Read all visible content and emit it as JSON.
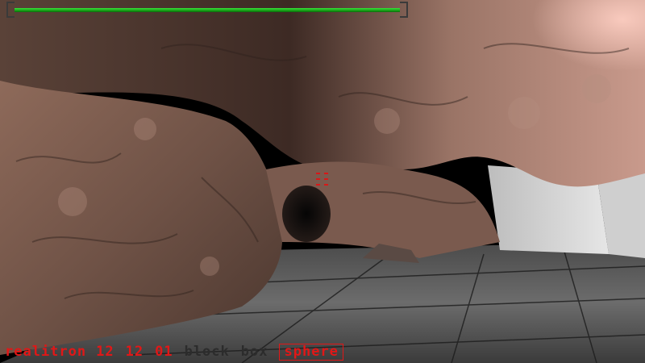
{
  "hud": {
    "health_percent": 100,
    "health_color": "#20c020",
    "engine_name": "realitron",
    "stats": [
      "12",
      "12",
      "01"
    ],
    "modes": [
      {
        "label": "block",
        "active": false
      },
      {
        "label": "box",
        "active": false
      },
      {
        "label": "sphere",
        "active": true
      }
    ],
    "active_color": "#e11717"
  }
}
